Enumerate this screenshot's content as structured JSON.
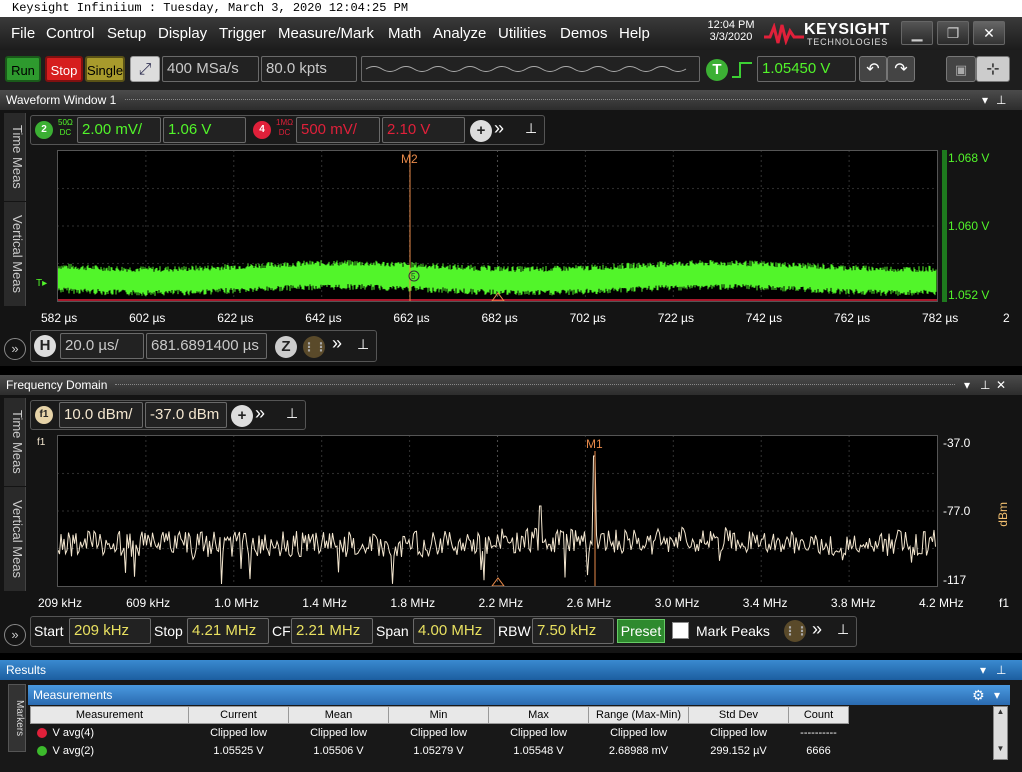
{
  "title_bar": "Keysight Infiniium : Tuesday, March 3, 2020 12:04:25 PM",
  "menu": [
    "File",
    "Control",
    "Setup",
    "Display",
    "Trigger",
    "Measure/Mark",
    "Math",
    "Analyze",
    "Utilities",
    "Demos",
    "Help"
  ],
  "clock": {
    "time": "12:04 PM",
    "date": "3/3/2020"
  },
  "brand": {
    "name": "KEYSIGHT",
    "sub": "TECHNOLOGIES"
  },
  "toolbar": {
    "run": "Run",
    "stop": "Stop",
    "single": "Single",
    "sample_rate": "400 MSa/s",
    "memory_depth": "80.0 kpts",
    "trigger_badge": "T",
    "trigger_level": "1.05450 V"
  },
  "waveform": {
    "title": "Waveform Window 1",
    "ch2": {
      "badge": "2",
      "coupling_top": "50Ω",
      "coupling_bottom": "DC",
      "scale": "2.00 mV/",
      "offset": "1.06 V"
    },
    "ch4": {
      "badge": "4",
      "coupling_top": "1MΩ",
      "coupling_bottom": "DC",
      "scale": "500 mV/",
      "offset": "2.10 V"
    },
    "marker": "M2",
    "marker_point": "5",
    "vtab_time": "Time Meas",
    "vtab_vert": "Vertical Meas",
    "y_labels": [
      "1.068 V",
      "1.060 V",
      "1.052 V"
    ],
    "x_labels": [
      "582 µs",
      "602 µs",
      "622 µs",
      "642 µs",
      "662 µs",
      "682 µs",
      "702 µs",
      "722 µs",
      "742 µs",
      "762 µs",
      "782 µs"
    ],
    "x_extra": "2",
    "h_badge": "H",
    "h_scale": "20.0 µs/",
    "h_position": "681.6891400 µs",
    "zoom_badge": "Z"
  },
  "freq": {
    "title": "Frequency Domain",
    "f1_badge": "f1",
    "scale": "10.0 dBm/",
    "ref": "-37.0 dBm",
    "marker": "M1",
    "trace_label": "f1",
    "vtab_time": "Time Meas",
    "vtab_vert": "Vertical Meas",
    "y_labels": [
      "-37.0",
      "-77.0",
      "-117"
    ],
    "y_unit": "dBm",
    "x_labels": [
      "209 kHz",
      "609 kHz",
      "1.0 MHz",
      "1.4 MHz",
      "1.8 MHz",
      "2.2 MHz",
      "2.6 MHz",
      "3.0 MHz",
      "3.4 MHz",
      "3.8 MHz",
      "4.2 MHz"
    ],
    "x_extra": "f1",
    "start_label": "Start",
    "start": "209 kHz",
    "stop_label": "Stop",
    "stop": "4.21 MHz",
    "cf_label": "CF",
    "cf": "2.21 MHz",
    "span_label": "Span",
    "span": "4.00 MHz",
    "rbw_label": "RBW",
    "rbw": "7.50 kHz",
    "preset": "Preset",
    "mark_peaks": "Mark Peaks"
  },
  "results": {
    "title": "Results",
    "section": "Measurements",
    "side_tab": "Markers",
    "columns": [
      "Measurement",
      "Current",
      "Mean",
      "Min",
      "Max",
      "Range (Max-Min)",
      "Std Dev",
      "Count"
    ],
    "rows": [
      {
        "name": "V avg(4)",
        "badge": "4",
        "color": "#e0203a",
        "current": "Clipped low",
        "mean": "Clipped low",
        "min": "Clipped low",
        "max": "Clipped low",
        "range": "Clipped low",
        "std": "Clipped low",
        "count": "----------"
      },
      {
        "name": "V avg(2)",
        "badge": "2",
        "color": "#3cba2c",
        "current": "1.05525 V",
        "mean": "1.05506 V",
        "min": "1.05279 V",
        "max": "1.05548 V",
        "range": "2.68988 mV",
        "std": "299.152 µV",
        "count": "6666"
      }
    ]
  },
  "colors": {
    "ch2": "#52f52a",
    "ch4": "#e0203a",
    "freq_trace": "#f3e6cf",
    "marker": "#e88a4a",
    "accent_green": "#3cb034"
  }
}
